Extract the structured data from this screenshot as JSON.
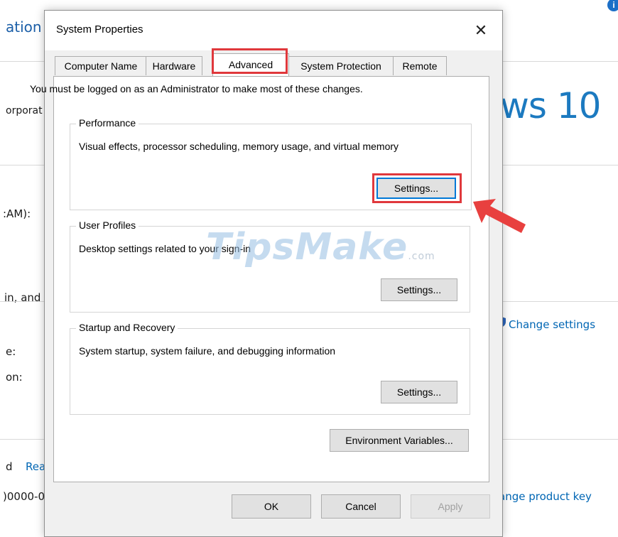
{
  "background": {
    "heading_fragment": "ation",
    "corporation_fragment": "orporat",
    "windows_brand": "ws 10",
    "ram_fragment": ":AM):",
    "pen_fragment": "in, and",
    "setting_fragment_1": "e:",
    "setting_fragment_2": "on:",
    "d_fragment": "d",
    "read_link": "Rea",
    "product_id_fragment": ")0000-0",
    "change_settings_link": "Change settings",
    "change_product_key_link": "ange product key",
    "info_icon_glyph": "i"
  },
  "dialog": {
    "title": "System Properties",
    "close_glyph": "✕",
    "tabs": [
      {
        "label": "Computer Name",
        "active": false
      },
      {
        "label": "Hardware",
        "active": false
      },
      {
        "label": "Advanced",
        "active": true
      },
      {
        "label": "System Protection",
        "active": false
      },
      {
        "label": "Remote",
        "active": false
      }
    ],
    "notice": "You must be logged on as an Administrator to make most of these changes.",
    "performance": {
      "title": "Performance",
      "description": "Visual effects, processor scheduling, memory usage, and virtual memory",
      "settings_label": "Settings..."
    },
    "user_profiles": {
      "title": "User Profiles",
      "description": "Desktop settings related to your sign-in",
      "settings_label": "Settings..."
    },
    "startup_recovery": {
      "title": "Startup and Recovery",
      "description": "System startup, system failure, and debugging information",
      "settings_label": "Settings..."
    },
    "environment_variables_label": "Environment Variables...",
    "ok_label": "OK",
    "cancel_label": "Cancel",
    "apply_label": "Apply"
  },
  "watermark": {
    "text": "TipsMake",
    "suffix": ".com"
  },
  "colors": {
    "highlight": "#e0383c",
    "accent": "#0078d7",
    "brand_blue": "#1c7ac0",
    "link": "#0066b4"
  },
  "icons": [
    "close-icon",
    "info-icon",
    "shield-icon",
    "pointer-arrow-icon"
  ]
}
